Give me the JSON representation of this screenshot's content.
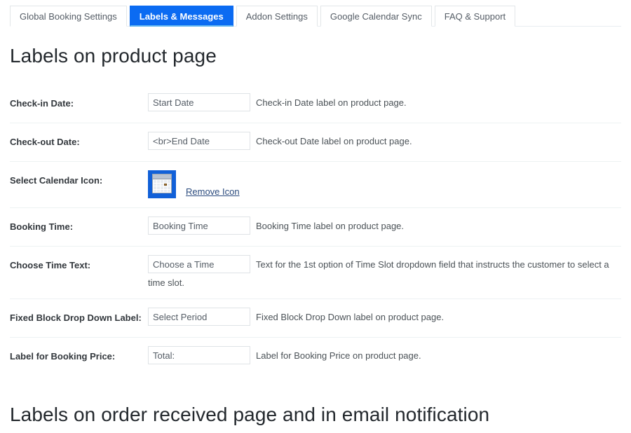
{
  "tabs": [
    {
      "label": "Global Booking Settings",
      "active": false
    },
    {
      "label": "Labels & Messages",
      "active": true
    },
    {
      "label": "Addon Settings",
      "active": false
    },
    {
      "label": "Google Calendar Sync",
      "active": false
    },
    {
      "label": "FAQ & Support",
      "active": false
    }
  ],
  "headings": {
    "product_page": "Labels on product page",
    "order_received": "Labels on order received page and in email notification"
  },
  "rows": {
    "checkin": {
      "label": "Check-in Date:",
      "value": "Start Date",
      "description": "Check-in Date label on product page."
    },
    "checkout": {
      "label": "Check-out Date:",
      "value": "<br>End Date",
      "description": "Check-out Date label on product page."
    },
    "calendar_icon": {
      "label": "Select Calendar Icon:",
      "remove_label": "Remove Icon",
      "icon_name": "calendar-icon"
    },
    "booking_time": {
      "label": "Booking Time:",
      "value": "Booking Time",
      "description": "Booking Time label on product page."
    },
    "choose_time": {
      "label": "Choose Time Text:",
      "value": "Choose a Time",
      "description_line1": "Text for the 1st option of Time Slot dropdown field that instructs the customer to select a",
      "description_line2": "time slot."
    },
    "fixed_block": {
      "label": "Fixed Block Drop Down Label:",
      "value": "Select Period",
      "description": "Fixed Block Drop Down label on product page."
    },
    "booking_price": {
      "label": "Label for Booking Price:",
      "value": "Total:",
      "description": "Label for Booking Price on product page."
    }
  },
  "colors": {
    "active_tab_bg": "#0b6bf2",
    "active_tab_underline": "#63b6f0",
    "icon_bg": "#1160d8",
    "link": "#2b4b7e",
    "divider": "#edf2f3",
    "heading": "#23282d"
  }
}
